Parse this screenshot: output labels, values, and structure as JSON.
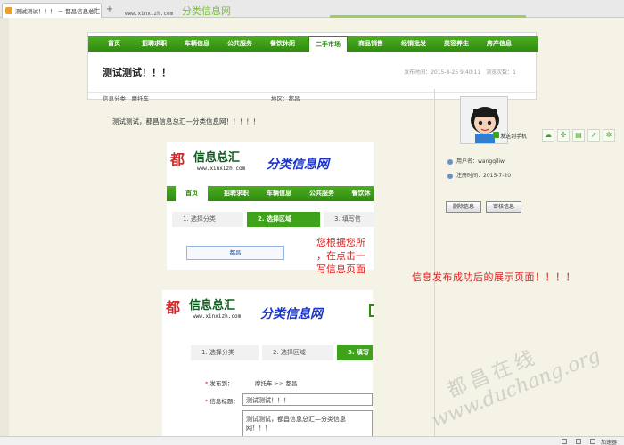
{
  "browser": {
    "tab_title": "测试测试！！！ － 都昌信息总汇",
    "strip_url": "www.xinxizh.com",
    "strip_ghost": "分类信息网"
  },
  "nav": {
    "items": [
      "首页",
      "招聘求职",
      "车辆信息",
      "公共服务",
      "餐饮休闲",
      "二手市场",
      "商品销售",
      "经销批发",
      "美容养生",
      "房产信息"
    ],
    "active": "二手市场"
  },
  "post": {
    "title": "测试测试！！！",
    "meta": "发布时间：2015-8-25 9:40:11　浏览次数：1",
    "category": "信息分类：摩托车",
    "region": "地区：都昌",
    "body": "测试测试，都昌信息总汇—分类信息网！！！！！"
  },
  "shot1": {
    "logo_mark": "都",
    "logo_cn": "信息总汇",
    "logo_url": "www.xinxizh.com",
    "slogan": "分类信息网",
    "nav": [
      "首页",
      "招聘求职",
      "车辆信息",
      "公共服务",
      "餐饮休"
    ],
    "steps": [
      "1. 选择分类",
      "2. 选择区域",
      "3. 填写信"
    ],
    "region_button": "都昌",
    "note": "您根据您所\n，在点击一\n写信息页面"
  },
  "shot2": {
    "logo_mark": "都",
    "logo_cn": "信息总汇",
    "logo_url": "www.xinxizh.com",
    "slogan": "分类信息网",
    "steps": [
      "1. 选择分类",
      "2. 选择区域",
      "3. 填写"
    ],
    "publish_label": "发布到：",
    "publish_value": "摩托车 >> 都昌",
    "title_label": "信息标题：",
    "title_value": "测试测试！！！",
    "desc_value": "测试测试，都昌信息总汇—分类信息网！！！"
  },
  "sidebar": {
    "sms_label": "发送到手机",
    "username": "用户名：wangqiliwi",
    "register": "注册时间：2015-7-20",
    "delete_button": "删除信息",
    "edit_button": "审核信息"
  },
  "caption": "信息发布成功后的展示页面！！！！",
  "watermark": {
    "cn": "都昌在线",
    "url": "www.duchang.org"
  },
  "statusbar": {
    "speed": "加速器"
  },
  "colors": {
    "nav_green": "#3ea31b",
    "note_red": "#e02020",
    "slogan_blue": "#1a34c9",
    "logo_green": "#0d5c1d"
  }
}
